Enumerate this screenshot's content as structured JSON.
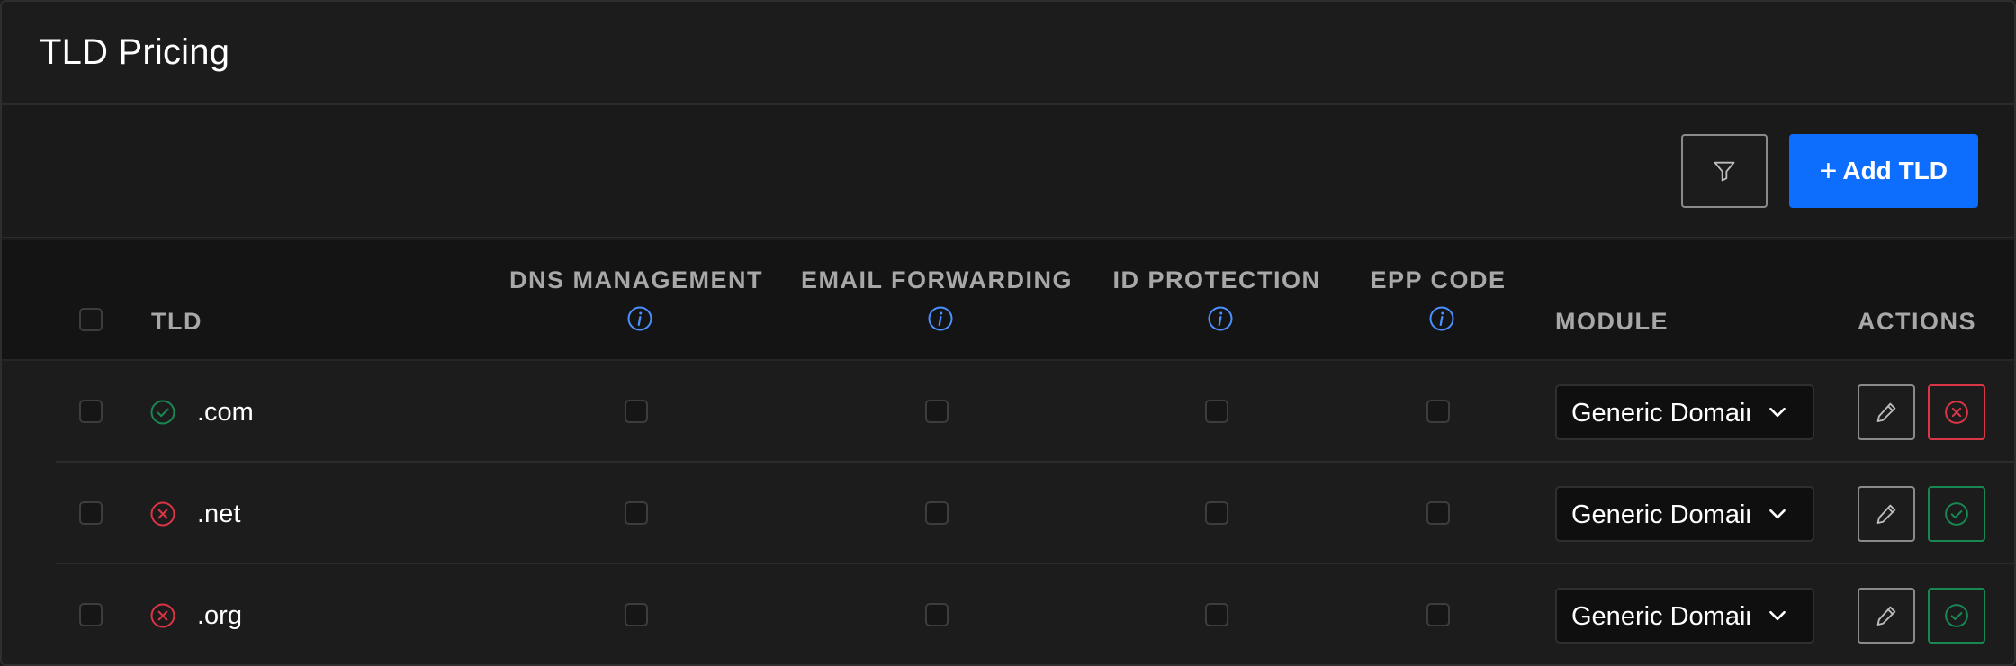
{
  "page": {
    "title": "TLD Pricing"
  },
  "toolbar": {
    "filter_icon": "filter-icon",
    "add_label": "Add TLD",
    "add_icon": "+"
  },
  "columns": {
    "tld": "TLD",
    "dns": "DNS MANAGEMENT",
    "email": "EMAIL FORWARDING",
    "idp": "ID PROTECTION",
    "epp": "EPP CODE",
    "module": "MODULE",
    "actions": "ACTIONS"
  },
  "colors": {
    "accent": "#0d6efd",
    "success": "#198754",
    "danger": "#dc3545",
    "info": "#4a90ff"
  },
  "rows": [
    {
      "tld": ".com",
      "active": true,
      "dns": false,
      "email": false,
      "idp": false,
      "epp": false,
      "module": "Generic Domain",
      "toggle": "deactivate"
    },
    {
      "tld": ".net",
      "active": false,
      "dns": false,
      "email": false,
      "idp": false,
      "epp": false,
      "module": "Generic Domain",
      "toggle": "activate"
    },
    {
      "tld": ".org",
      "active": false,
      "dns": false,
      "email": false,
      "idp": false,
      "epp": false,
      "module": "Generic Domain",
      "toggle": "activate"
    }
  ]
}
